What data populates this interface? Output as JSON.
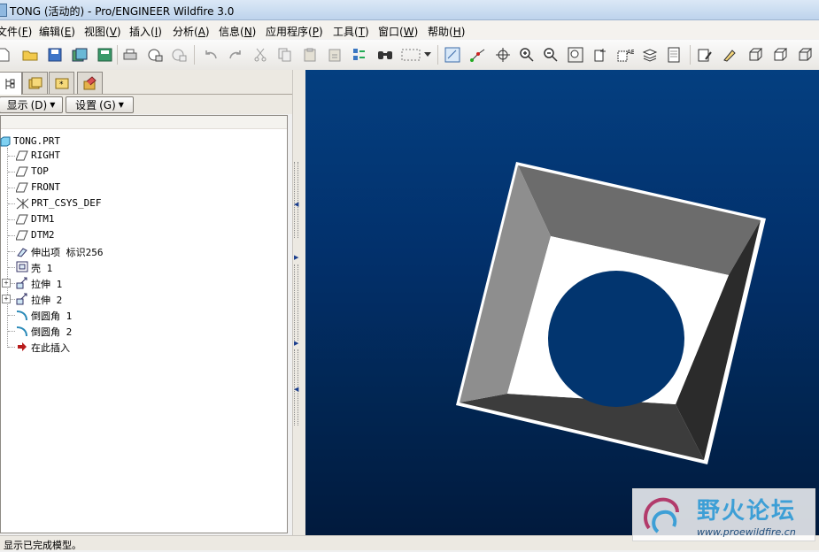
{
  "window": {
    "title": "TONG (活动的) - Pro/ENGINEER Wildfire 3.0"
  },
  "menubar": {
    "items": [
      {
        "label": "文件(",
        "key": "F",
        "end": ")"
      },
      {
        "label": "编辑(",
        "key": "E",
        "end": ")"
      },
      {
        "label": "视图(",
        "key": "V",
        "end": ")"
      },
      {
        "label": "插入(",
        "key": "I",
        "end": ")"
      },
      {
        "label": "分析(",
        "key": "A",
        "end": ")"
      },
      {
        "label": "信息(",
        "key": "N",
        "end": ")"
      },
      {
        "label": "应用程序(",
        "key": "P",
        "end": ")"
      },
      {
        "label": "工具(",
        "key": "T",
        "end": ")"
      },
      {
        "label": "窗口(",
        "key": "W",
        "end": ")"
      },
      {
        "label": "帮助(",
        "key": "H",
        "end": ")"
      }
    ]
  },
  "toolbar": {
    "icons": [
      "new-file-icon",
      "open-folder-icon",
      "save-icon",
      "save-copy-icon",
      "print-icon",
      "email-icon",
      "email-link-icon",
      "undo-icon",
      "redo-icon",
      "cut-icon",
      "copy-icon",
      "paste-icon",
      "paste-special-icon",
      "regenerate-icon",
      "find-icon",
      "select-box-icon",
      "repaint-icon",
      "spin-center-icon",
      "orient-icon",
      "zoom-in-icon",
      "zoom-out-icon",
      "refit-icon",
      "saved-views-icon",
      "layers-icon",
      "view-manager-icon",
      "appearance-icon",
      "color-icon",
      "wireframe-icon",
      "hidden-line-icon",
      "no-hidden-icon"
    ]
  },
  "sidebar": {
    "tabs": [
      "model-tree-tab-icon",
      "folder-browser-tab-icon",
      "favorites-tab-icon",
      "connections-tab-icon"
    ],
    "show_label": "显示",
    "show_key": "(D)",
    "settings_label": "设置",
    "settings_key": "(G)"
  },
  "model_tree": {
    "root": "TONG.PRT",
    "items": [
      {
        "label": "RIGHT",
        "icon": "datum-plane-icon"
      },
      {
        "label": "TOP",
        "icon": "datum-plane-icon"
      },
      {
        "label": "FRONT",
        "icon": "datum-plane-icon"
      },
      {
        "label": "PRT_CSYS_DEF",
        "icon": "coordinate-system-icon"
      },
      {
        "label": "DTM1",
        "icon": "datum-plane-icon"
      },
      {
        "label": "DTM2",
        "icon": "datum-plane-icon"
      },
      {
        "label": "伸出项 标识256",
        "icon": "protrusion-icon"
      },
      {
        "label": "壳 1",
        "icon": "shell-icon"
      },
      {
        "label": "拉伸 1",
        "icon": "extrude-icon",
        "expandable": true
      },
      {
        "label": "拉伸 2",
        "icon": "extrude-icon",
        "expandable": true
      },
      {
        "label": "倒圆角 1",
        "icon": "round-icon"
      },
      {
        "label": "倒圆角 2",
        "icon": "round-icon"
      },
      {
        "label": "在此插入",
        "icon": "insert-here-icon"
      }
    ]
  },
  "status": {
    "text": "显示已完成模型。"
  },
  "watermark": {
    "title": "野火论坛",
    "url": "www.proewildfire.cn"
  }
}
